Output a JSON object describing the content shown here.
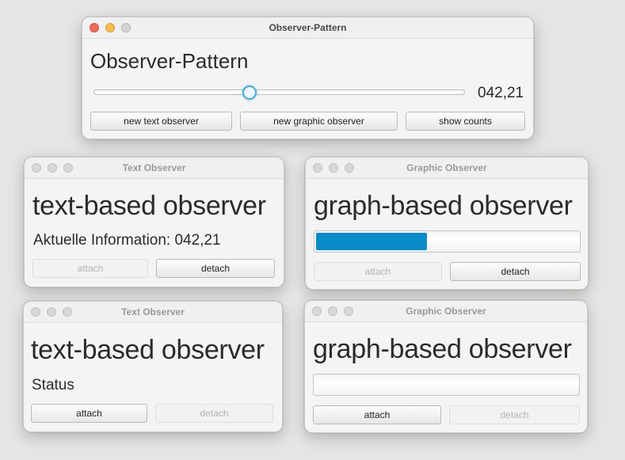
{
  "main_window": {
    "title": "Observer-Pattern",
    "heading": "Observer-Pattern",
    "slider_value": 42.21,
    "slider_max": 100,
    "value_label": "042,21",
    "buttons": {
      "new_text": "new text observer",
      "new_graphic": "new graphic observer",
      "show_counts": "show counts"
    }
  },
  "text_observer_1": {
    "title": "Text Observer",
    "heading": "text-based observer",
    "info": "Aktuelle Information: 042,21",
    "attach": "attach",
    "detach": "detach"
  },
  "graphic_observer_1": {
    "title": "Graphic Observer",
    "heading": "graph-based observer",
    "progress": 0.4221,
    "attach": "attach",
    "detach": "detach"
  },
  "text_observer_2": {
    "title": "Text Observer",
    "heading": "text-based observer",
    "info": "Status",
    "attach": "attach",
    "detach": "detach"
  },
  "graphic_observer_2": {
    "title": "Graphic Observer",
    "heading": "graph-based observer",
    "progress": 0,
    "attach": "attach",
    "detach": "detach"
  },
  "colors": {
    "accent": "#0b8ac8",
    "slider_thumb": "#49a9d6",
    "close": "#ed6a5e",
    "minimize": "#f5bf4f"
  }
}
